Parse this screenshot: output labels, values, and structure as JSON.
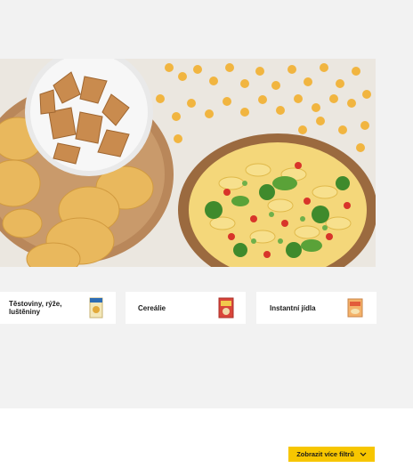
{
  "categories": [
    {
      "label": "Těstoviny, rýže, luštěniny",
      "icon": "pasta-package-icon"
    },
    {
      "label": "Cereálie",
      "icon": "cereal-box-icon"
    },
    {
      "label": "Instantní jídla",
      "icon": "instant-meal-package-icon"
    }
  ],
  "filters": {
    "button_label": "Zobrazit více filtrů",
    "icon": "chevron-down-icon"
  },
  "colors": {
    "accent": "#f7c600",
    "background": "#f2f2f2",
    "card": "#ffffff"
  }
}
